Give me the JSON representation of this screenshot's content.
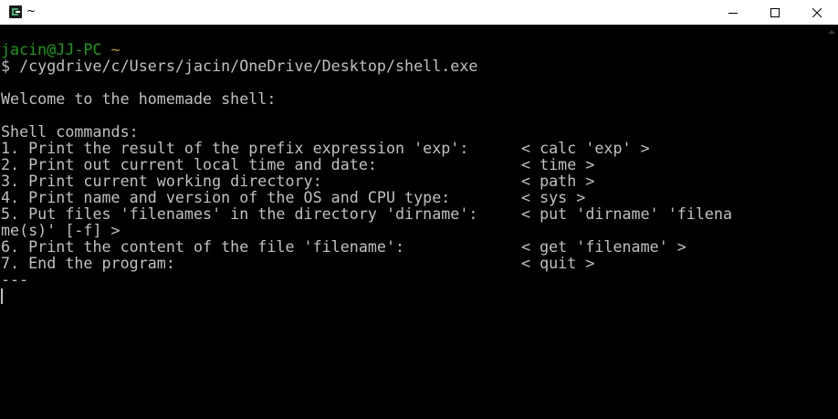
{
  "window": {
    "title": "~",
    "icon": "cygwin-icon",
    "controls": {
      "minimize_icon": "minimize-icon",
      "maximize_icon": "maximize-icon",
      "close_icon": "close-icon"
    }
  },
  "terminal": {
    "prompt_user": "jacin@JJ-PC",
    "prompt_path": "~",
    "command_line": "$ /cygdrive/c/Users/jacin/OneDrive/Desktop/shell.exe",
    "welcome": "Welcome to the homemade shell:",
    "commands_header": "Shell commands:",
    "commands": [
      {
        "desc": "1. Print the result of the prefix expression 'exp':",
        "syntax": "< calc 'exp' >"
      },
      {
        "desc": "2. Print out current local time and date:",
        "syntax": "< time >"
      },
      {
        "desc": "3. Print current working directory:",
        "syntax": "< path >"
      },
      {
        "desc": "4. Print name and version of the OS and CPU type:",
        "syntax": "< sys >"
      },
      {
        "desc": "5. Put files 'filenames' in the directory 'dirname':",
        "syntax": "< put 'dirname' 'filena"
      },
      {
        "desc": "6. Print the content of the file 'filename':",
        "syntax": "< get 'filename' >"
      },
      {
        "desc": "7. End the program:",
        "syntax": "< quit >"
      }
    ],
    "wrap_continuation": "me(s)' [-f] >",
    "separator": "---"
  },
  "colors": {
    "background": "#000000",
    "text": "#c0c0c0",
    "prompt_user": "#13a10e",
    "prompt_path": "#c19c00"
  }
}
